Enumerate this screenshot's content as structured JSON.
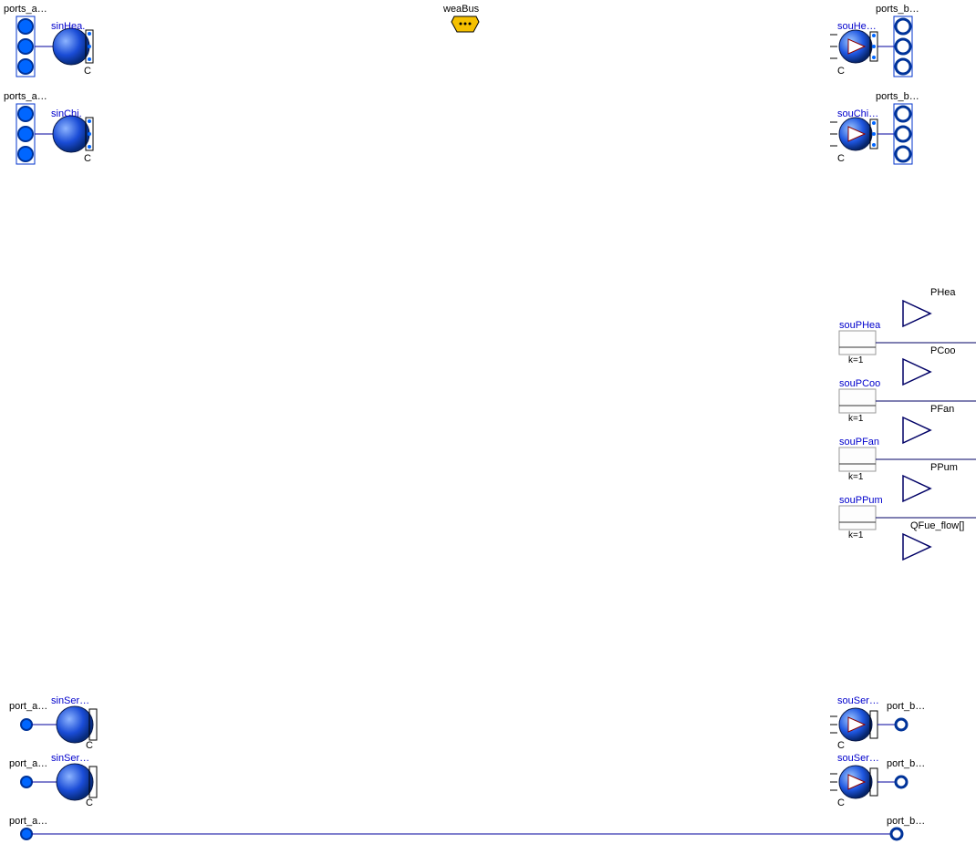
{
  "bus": {
    "weaBus": "weaBus"
  },
  "ports": {
    "topLeft1": "ports_a…",
    "topLeft2": "ports_a…",
    "topRight1": "ports_b…",
    "topRight2": "ports_b…",
    "leftA1": "port_a…",
    "leftA2": "port_a…",
    "leftA3": "port_a…",
    "rightB1": "port_b…",
    "rightB2": "port_b…",
    "rightB3": "port_b…"
  },
  "comp": {
    "sinHea": "sinHea.",
    "sinChi": "sinChi.",
    "souHea": "souHe…",
    "souChi": "souChi…",
    "sinSer1": "sinSer…",
    "sinSer2": "sinSer…",
    "souSer1": "souSer…",
    "souSer2": "souSer…",
    "souPHea": "souPHea",
    "souPCoo": "souPCoo",
    "souPFan": "souPFan",
    "souPPum": "souPPum",
    "cLetter": "C",
    "k1": "k=1"
  },
  "out": {
    "PHea": "PHea",
    "PCoo": "PCoo",
    "PFan": "PFan",
    "PPum": "PPum",
    "QFue": "QFue_flow[]"
  }
}
